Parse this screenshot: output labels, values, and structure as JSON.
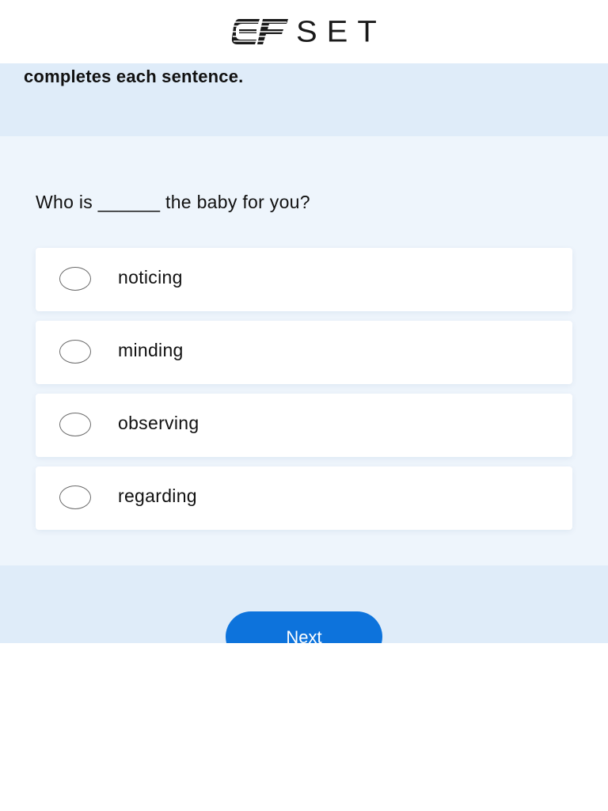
{
  "header": {
    "logo_icon": "ef-logo-mark",
    "logo_text": "SET"
  },
  "instruction": {
    "text": "completes each sentence."
  },
  "question": {
    "text": "Who is ______ the baby for you?"
  },
  "options": [
    {
      "label": "noticing",
      "selected": false
    },
    {
      "label": "minding",
      "selected": false
    },
    {
      "label": "observing",
      "selected": false
    },
    {
      "label": "regarding",
      "selected": false
    }
  ],
  "footer": {
    "next_label": "Next"
  },
  "colors": {
    "brand_blue": "#0d73dc",
    "band_blue": "#dfecf9",
    "panel_blue": "#eef5fc"
  }
}
